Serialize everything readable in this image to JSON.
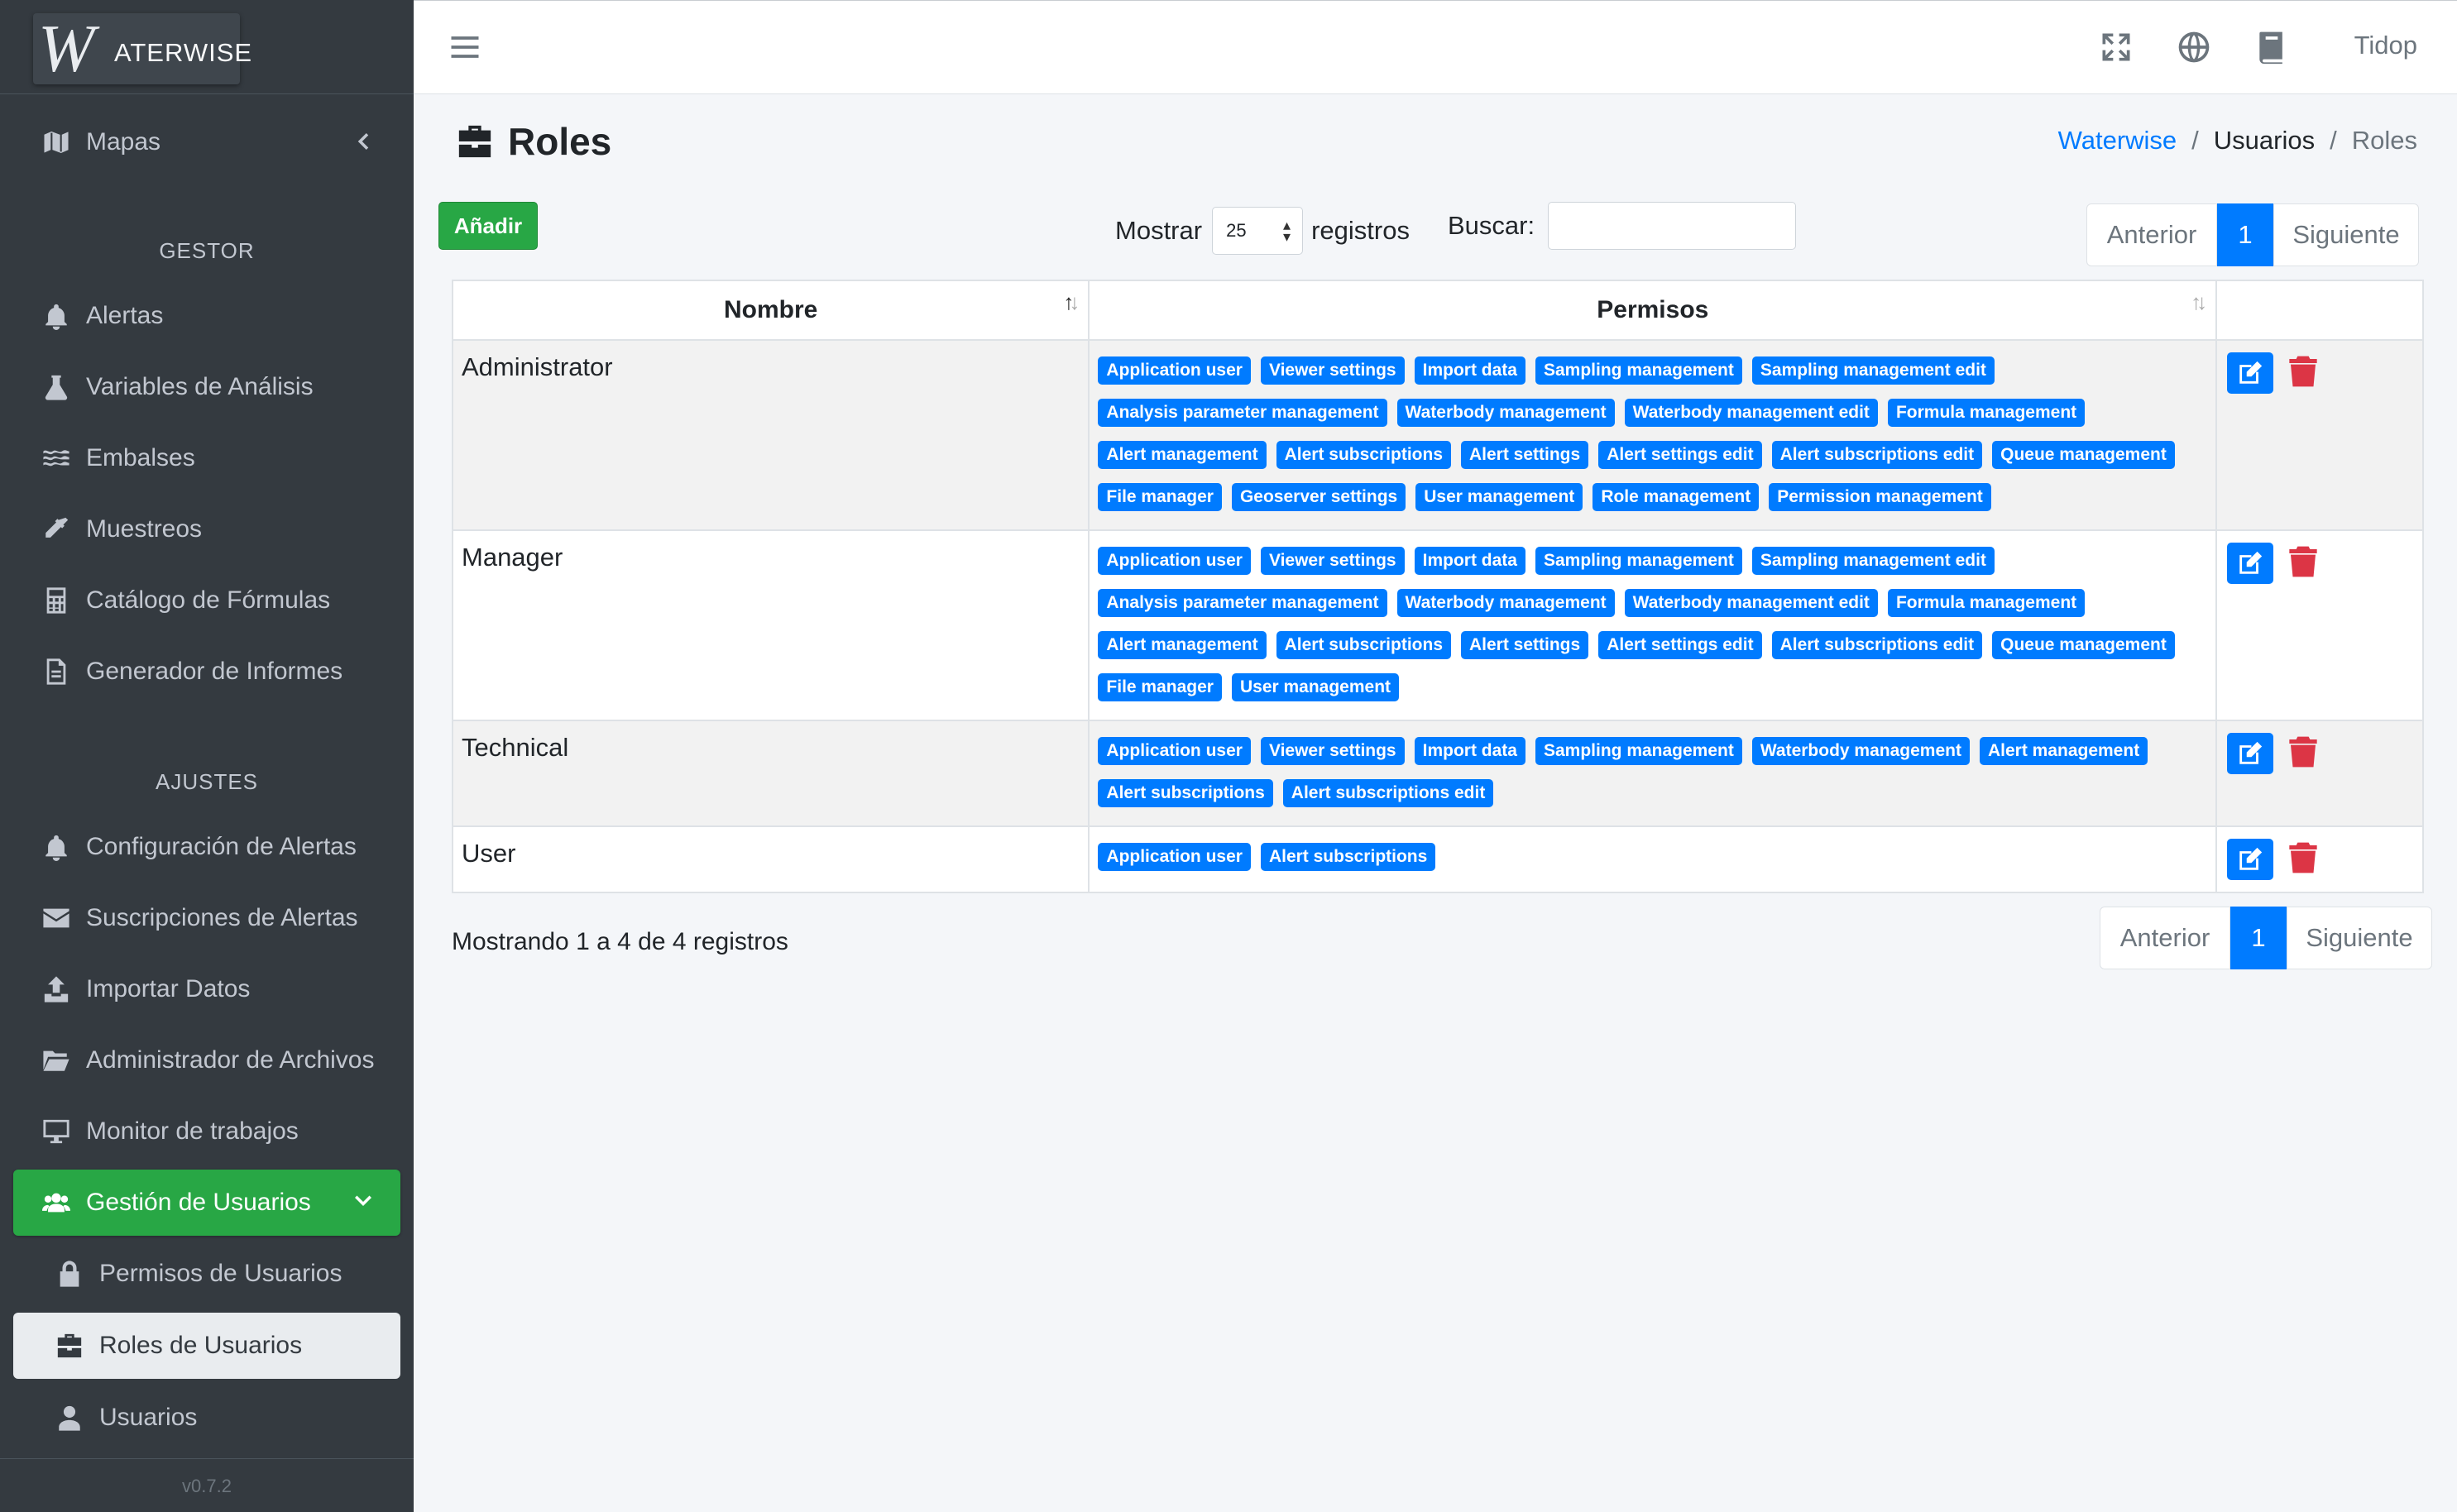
{
  "brand": {
    "logo_text": "WATERWISE",
    "logo_letter": "W",
    "logo_rest": "ATERWISE"
  },
  "sidebar": {
    "top_item": {
      "label": "Mapas",
      "icon": "map-icon"
    },
    "section_gestor": "GESTOR",
    "gestor_items": [
      {
        "label": "Alertas",
        "icon": "bell-icon"
      },
      {
        "label": "Variables de Análisis",
        "icon": "flask-icon"
      },
      {
        "label": "Embalses",
        "icon": "water-icon"
      },
      {
        "label": "Muestreos",
        "icon": "eyedropper-icon"
      },
      {
        "label": "Catálogo de Fórmulas",
        "icon": "calculator-icon"
      },
      {
        "label": "Generador de Informes",
        "icon": "file-icon"
      }
    ],
    "section_ajustes": "AJUSTES",
    "ajustes_items": [
      {
        "label": "Configuración de Alertas",
        "icon": "bell-icon"
      },
      {
        "label": "Suscripciones de Alertas",
        "icon": "envelope-icon"
      },
      {
        "label": "Importar Datos",
        "icon": "upload-icon"
      },
      {
        "label": "Administrador de Archivos",
        "icon": "folder-icon"
      },
      {
        "label": "Monitor de trabajos",
        "icon": "desktop-icon"
      }
    ],
    "active_group": {
      "label": "Gestión de Usuarios",
      "icon": "users-icon"
    },
    "sub_items": [
      {
        "label": "Permisos de Usuarios",
        "icon": "lock-icon"
      },
      {
        "label": "Roles de Usuarios",
        "icon": "briefcase-icon"
      },
      {
        "label": "Usuarios",
        "icon": "user-icon"
      }
    ],
    "version": "v0.7.2"
  },
  "topbar": {
    "user": "Tidop"
  },
  "page": {
    "title": "Roles"
  },
  "breadcrumb": {
    "root": "Waterwise",
    "middle": "Usuarios",
    "current": "Roles",
    "sep": "/"
  },
  "controls": {
    "add_label": "Añadir",
    "show_label": "Mostrar",
    "show_value": "25",
    "records_label": "registros",
    "search_label": "Buscar:",
    "search_value": ""
  },
  "pagination": {
    "prev": "Anterior",
    "page": "1",
    "next": "Siguiente"
  },
  "table": {
    "headers": {
      "name": "Nombre",
      "perms": "Permisos"
    },
    "rows": [
      {
        "name": "Administrator",
        "perms": [
          "Application user",
          "Viewer settings",
          "Import data",
          "Sampling management",
          "Sampling management edit",
          "Analysis parameter management",
          "Waterbody management",
          "Waterbody management edit",
          "Formula management",
          "Alert management",
          "Alert subscriptions",
          "Alert settings",
          "Alert settings edit",
          "Alert subscriptions edit",
          "Queue management",
          "File manager",
          "Geoserver settings",
          "User management",
          "Role management",
          "Permission management"
        ]
      },
      {
        "name": "Manager",
        "perms": [
          "Application user",
          "Viewer settings",
          "Import data",
          "Sampling management",
          "Sampling management edit",
          "Analysis parameter management",
          "Waterbody management",
          "Waterbody management edit",
          "Formula management",
          "Alert management",
          "Alert subscriptions",
          "Alert settings",
          "Alert settings edit",
          "Alert subscriptions edit",
          "Queue management",
          "File manager",
          "User management"
        ]
      },
      {
        "name": "Technical",
        "perms": [
          "Application user",
          "Viewer settings",
          "Import data",
          "Sampling management",
          "Waterbody management",
          "Alert management",
          "Alert subscriptions",
          "Alert subscriptions edit"
        ]
      },
      {
        "name": "User",
        "perms": [
          "Application user",
          "Alert subscriptions"
        ]
      }
    ]
  },
  "info": "Mostrando 1 a 4 de 4 registros"
}
